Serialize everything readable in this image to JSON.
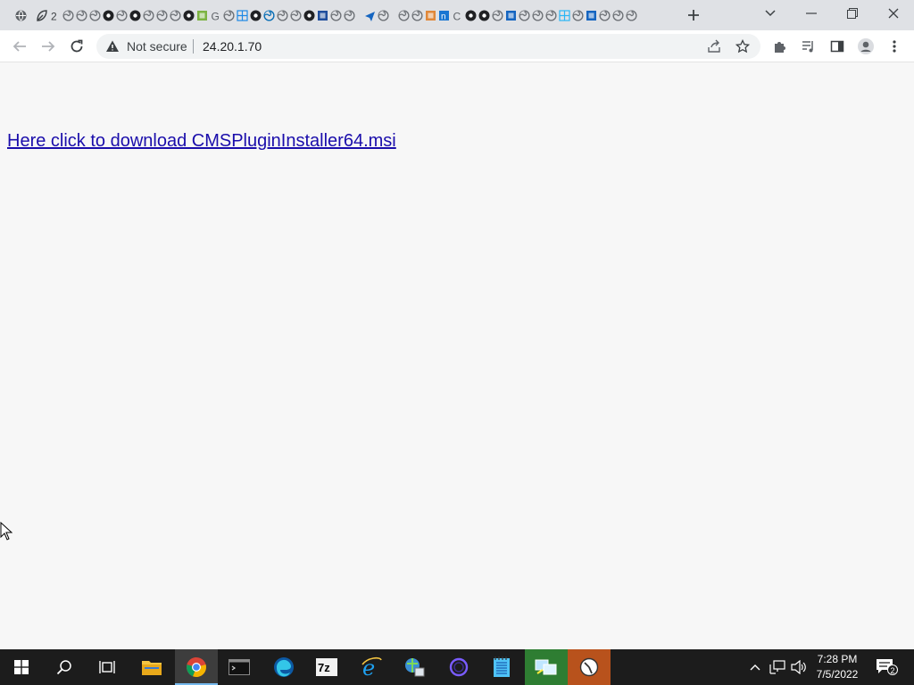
{
  "browser": {
    "tabs": {
      "favicons": [
        "globe-icon",
        "leaf-icon",
        "number-2-icon",
        "generic-site-icon",
        "generic-site-icon",
        "generic-site-icon",
        "dark-site-icon",
        "generic-site-icon",
        "dark-site-icon",
        "generic-site-icon",
        "generic-site-icon",
        "generic-site-icon",
        "dark-site-icon",
        "v-green-icon",
        "g-icon",
        "generic-site-icon",
        "blue-grid-icon",
        "dark-site-icon",
        "blue-swirl-icon",
        "generic-site-icon",
        "generic-site-icon",
        "dark-site-icon",
        "rm-blue-icon",
        "generic-site-icon",
        "generic-site-icon",
        "plane-icon",
        "generic-site-icon",
        "generic-site-icon",
        "generic-site-icon",
        "orange-box-icon",
        "blue-n-icon",
        "c-icon",
        "dark-site-icon",
        "dark-site-icon",
        "generic-site-icon",
        "blue-square-icon",
        "generic-site-icon",
        "generic-site-icon",
        "generic-site-icon",
        "grid-cyan-icon",
        "generic-site-icon",
        "blue-square-icon",
        "generic-site-icon",
        "generic-site-icon",
        "generic-site-icon"
      ],
      "new_tab_icon": "plus-icon"
    },
    "address_bar": {
      "security_label": "Not secure",
      "url": "24.20.1.70"
    }
  },
  "page": {
    "download_link_text": "Here click to download CMSPluginInstaller64.msi"
  },
  "taskbar": {
    "apps": [
      "start",
      "search",
      "task-view",
      "file-explorer",
      "chrome",
      "terminal",
      "edge",
      "7zip",
      "internet-explorer",
      "network-tool",
      "cortana-circle",
      "notepad",
      "remote-desktop",
      "clock-app"
    ],
    "clock_time": "7:28 PM",
    "clock_date": "7/5/2022",
    "notification_count": "2"
  },
  "colors": {
    "link": "#1a0dab",
    "page_bg": "#f7f7f7",
    "tabstrip_bg": "#dfe1e5",
    "taskbar_bg": "#1c1c1c"
  }
}
